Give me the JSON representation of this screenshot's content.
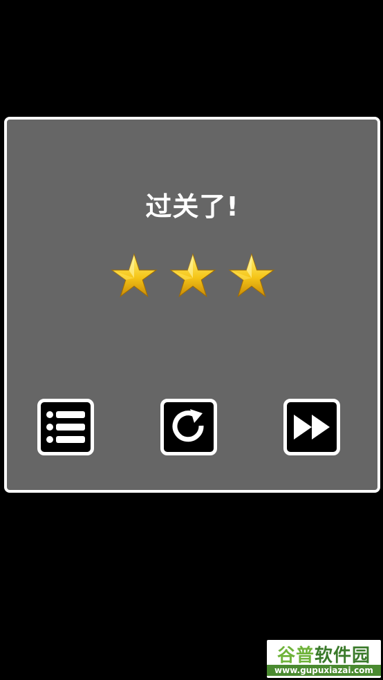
{
  "dialog": {
    "title": "过关了!",
    "stars_earned": 3,
    "stars_total": 3
  },
  "buttons": {
    "menu_icon": "list-menu-icon",
    "retry_icon": "restart-icon",
    "next_icon": "fast-forward-icon"
  },
  "colors": {
    "background": "#000000",
    "panel": "#666666",
    "panel_border": "#ffffff",
    "star_gold": "#f5c518",
    "button_bg": "#000000"
  },
  "watermark": {
    "logo_part1": "谷普",
    "logo_part2": "软件园",
    "url": "www.gupuxiazai.com"
  }
}
